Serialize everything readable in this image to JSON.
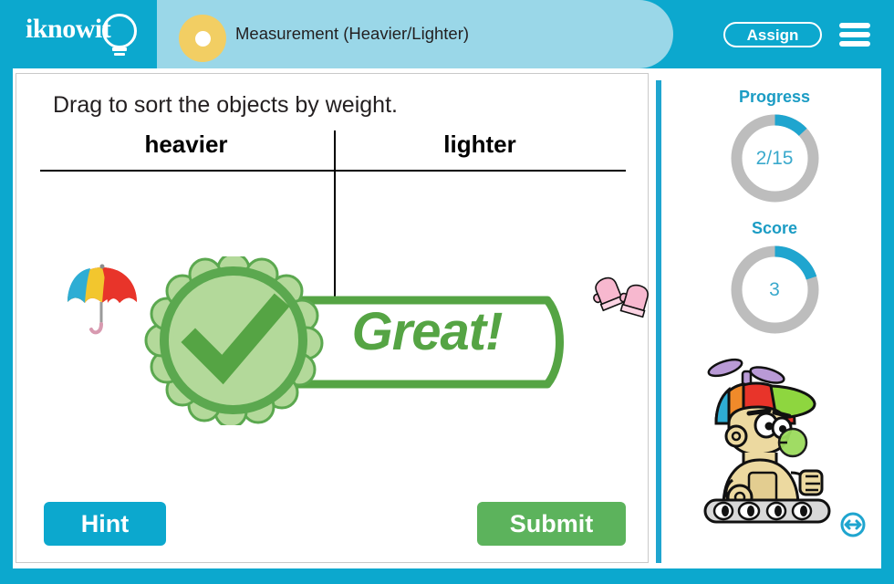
{
  "header": {
    "logo_text": "iknowit",
    "logo_icon": "lightbulb-icon",
    "topic_title": "Measurement (Heavier/Lighter)",
    "topic_dot_color": "#f2ce63",
    "assign_label": "Assign",
    "menu_icon": "hamburger-menu-icon",
    "bg_color": "#0ca8ce",
    "pill_color": "#9ad7e8"
  },
  "main": {
    "instruction": "Drag to sort the objects by weight.",
    "columns": [
      {
        "label": "heavier"
      },
      {
        "label": "lighter"
      }
    ],
    "objects": [
      {
        "name": "umbrella",
        "column": "heavier",
        "icon": "umbrella-icon"
      },
      {
        "name": "mittens",
        "column": "lighter",
        "icon": "mittens-icon"
      }
    ],
    "feedback": {
      "text": "Great!",
      "icon": "checkmark-rosette-icon",
      "color": "#55a444",
      "visible": true
    },
    "hint_label": "Hint",
    "submit_label": "Submit",
    "hint_color": "#0ca8ce",
    "submit_color": "#5cb35c"
  },
  "sidebar": {
    "progress": {
      "label": "Progress",
      "value": "2/15",
      "current": 2,
      "total": 15,
      "percent": 13,
      "arc_color": "#1fa5cf",
      "track_color": "#bdbdbd"
    },
    "score": {
      "label": "Score",
      "value": "3",
      "percent": 20,
      "arc_color": "#1fa5cf",
      "track_color": "#bdbdbd"
    },
    "mascot_icon": "robot-mascot-icon",
    "resize_icon": "resize-horizontal-icon"
  }
}
